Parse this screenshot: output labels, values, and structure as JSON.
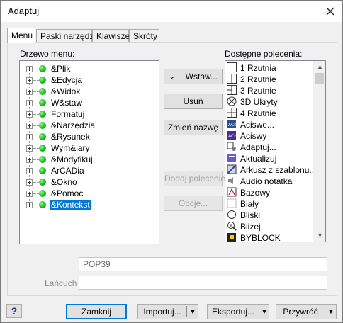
{
  "window": {
    "title": "Adaptuj"
  },
  "tabs": [
    {
      "label": "Menu"
    },
    {
      "label": "Paski narzędzi"
    },
    {
      "label": "Klawisze"
    },
    {
      "label": "Skróty"
    }
  ],
  "tree": {
    "label": "Drzewo menu:",
    "items": [
      {
        "label": "&Plik"
      },
      {
        "label": "&Edycja"
      },
      {
        "label": "&Widok"
      },
      {
        "label": "W&staw"
      },
      {
        "label": "Formatuj"
      },
      {
        "label": "&Narzędzia"
      },
      {
        "label": "&Rysunek"
      },
      {
        "label": "Wym&iary"
      },
      {
        "label": "&Modyfikuj"
      },
      {
        "label": "ArCADia"
      },
      {
        "label": "&Okno"
      },
      {
        "label": "&Pomoc"
      },
      {
        "label": "&Kontekst"
      }
    ],
    "selected": "&Kontekst"
  },
  "middle_buttons": {
    "insert": "Wstaw...",
    "remove": "Usuń",
    "rename": "Zmień nazwę",
    "add_command": "Dodaj polecenie",
    "options": "Opcje..."
  },
  "commands": {
    "label": "Dostępne polecenia:",
    "items": [
      {
        "label": "1 Rzutnia",
        "icon": "single-viewport-icon"
      },
      {
        "label": "2 Rzutnie",
        "icon": "two-viewports-icon"
      },
      {
        "label": "3 Rzutnie",
        "icon": "three-viewports-icon"
      },
      {
        "label": "3D Ukryty",
        "icon": "hide-3d-icon"
      },
      {
        "label": "4 Rzutnie",
        "icon": "four-viewports-icon"
      },
      {
        "label": "Aciswe...",
        "icon": "acis-in-icon"
      },
      {
        "label": "Aciswy",
        "icon": "acis-out-icon"
      },
      {
        "label": "Adaptuj...",
        "icon": "customize-icon"
      },
      {
        "label": "Aktualizuj",
        "icon": "update-icon"
      },
      {
        "label": "Arkusz z szablonu...",
        "icon": "sheet-template-icon"
      },
      {
        "label": "Audio notatka",
        "icon": "audio-note-icon"
      },
      {
        "label": "Bazowy",
        "icon": "base-icon"
      },
      {
        "label": "Biały",
        "icon": "white-color-icon"
      },
      {
        "label": "Bliski",
        "icon": "nearest-icon"
      },
      {
        "label": "Bliżej",
        "icon": "zoom-in-icon"
      },
      {
        "label": "BYBLOCK",
        "icon": "byblock-icon"
      }
    ]
  },
  "fields": {
    "command_name": "POP39",
    "chain_label": "Łańcuch",
    "chain_value": ""
  },
  "footer": {
    "help": "?",
    "close": "Zamknij",
    "import": "Importuj...",
    "export": "Eksportuj...",
    "restore": "Przywróć"
  },
  "colors": {
    "accent": "#0078d7",
    "tree_dot": "#1fae1f"
  }
}
